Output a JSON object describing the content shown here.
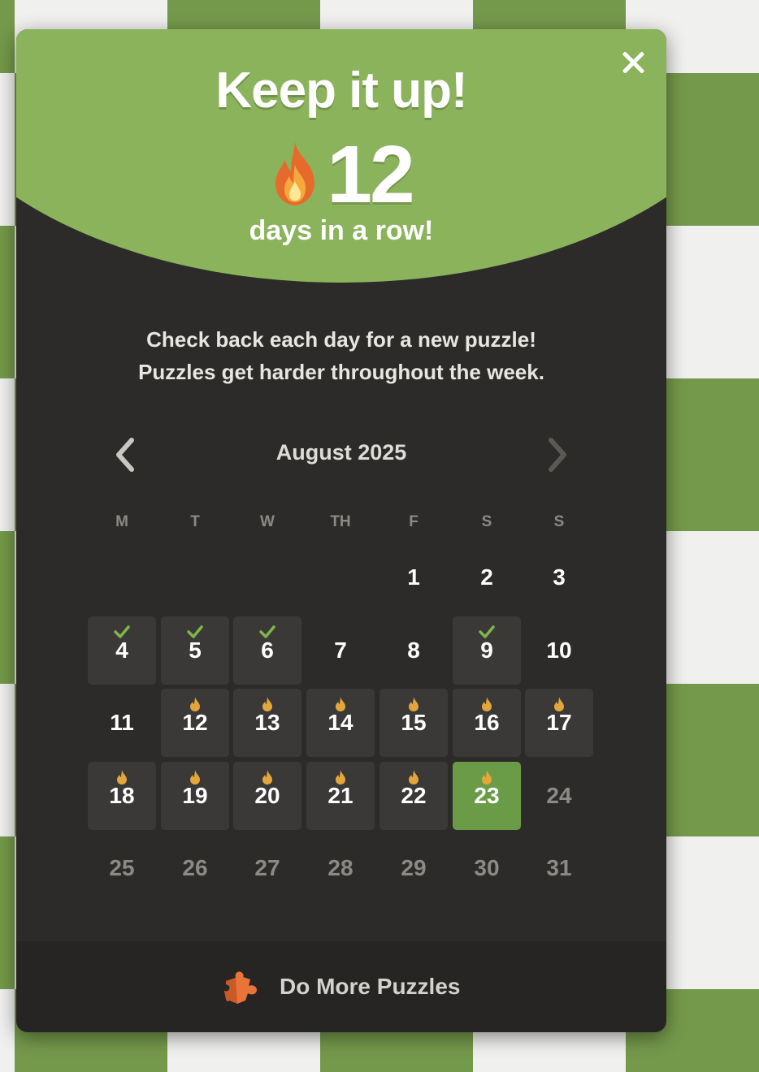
{
  "header": {
    "headline": "Keep it up!",
    "streak_count": "12",
    "streak_caption": "days in a row!"
  },
  "message": {
    "line1": "Check back each day for a new puzzle!",
    "line2": "Puzzles get harder throughout the week."
  },
  "calendar": {
    "month_label": "August 2025",
    "weekdays": [
      "M",
      "T",
      "W",
      "TH",
      "F",
      "S",
      "S"
    ],
    "first_weekday_index": 4,
    "days": [
      {
        "day": "1",
        "status": "none"
      },
      {
        "day": "2",
        "status": "none"
      },
      {
        "day": "3",
        "status": "none"
      },
      {
        "day": "4",
        "status": "solved"
      },
      {
        "day": "5",
        "status": "solved"
      },
      {
        "day": "6",
        "status": "solved"
      },
      {
        "day": "7",
        "status": "none"
      },
      {
        "day": "8",
        "status": "none"
      },
      {
        "day": "9",
        "status": "solved"
      },
      {
        "day": "10",
        "status": "none"
      },
      {
        "day": "11",
        "status": "none"
      },
      {
        "day": "12",
        "status": "streak"
      },
      {
        "day": "13",
        "status": "streak"
      },
      {
        "day": "14",
        "status": "streak"
      },
      {
        "day": "15",
        "status": "streak"
      },
      {
        "day": "16",
        "status": "streak"
      },
      {
        "day": "17",
        "status": "streak"
      },
      {
        "day": "18",
        "status": "streak"
      },
      {
        "day": "19",
        "status": "streak"
      },
      {
        "day": "20",
        "status": "streak"
      },
      {
        "day": "21",
        "status": "streak"
      },
      {
        "day": "22",
        "status": "streak"
      },
      {
        "day": "23",
        "status": "today"
      },
      {
        "day": "24",
        "status": "future"
      },
      {
        "day": "25",
        "status": "future"
      },
      {
        "day": "26",
        "status": "future"
      },
      {
        "day": "27",
        "status": "future"
      },
      {
        "day": "28",
        "status": "future"
      },
      {
        "day": "29",
        "status": "future"
      },
      {
        "day": "30",
        "status": "future"
      },
      {
        "day": "31",
        "status": "future"
      }
    ]
  },
  "footer": {
    "label": "Do More Puzzles",
    "icon": "puzzle-piece-icon"
  },
  "icons": {
    "close": "close-icon",
    "flame": "flame-icon",
    "prev": "chevron-left-icon",
    "next": "chevron-right-icon",
    "check": "check-icon"
  },
  "colors": {
    "header_green": "#8bb35b",
    "modal_bg": "#2c2b29",
    "today_green": "#6a9c48",
    "check_green": "#7fb54a",
    "flame_gold": "#e3a63d",
    "flame_orange": "#e66a2c"
  }
}
